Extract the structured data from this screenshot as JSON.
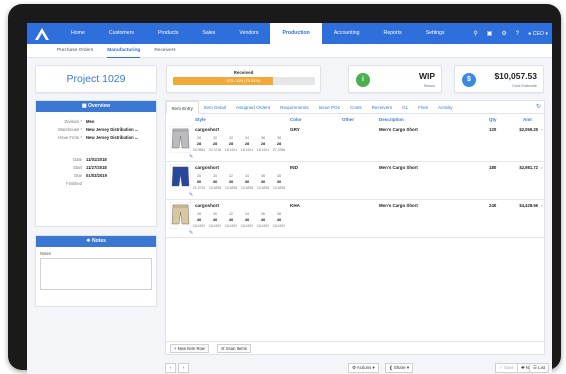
{
  "nav": {
    "items": [
      "Home",
      "Customers",
      "Products",
      "Sales",
      "Vendors",
      "Production",
      "Accounting",
      "Reports",
      "Settings"
    ],
    "active_index": 5,
    "user": "CEO",
    "icons": [
      "search-icon",
      "gift-icon",
      "gear-icon",
      "help-icon",
      "user-icon"
    ]
  },
  "subnav": {
    "items": [
      "Purchase Orders",
      "Manufacturing",
      "Receivers"
    ],
    "active_index": 1
  },
  "project": {
    "title": "Project 1029"
  },
  "received": {
    "label": "Received",
    "progress_text": "373 / 529 (70.51%)",
    "progress_fraction": 0.7051
  },
  "status": {
    "value": "WIP",
    "label": "Status",
    "icon_letter": "i"
  },
  "cost": {
    "value": "$10,057.53",
    "label": "Cost Estimate",
    "icon_letter": "$"
  },
  "overview": {
    "title": "Overview",
    "rows": [
      {
        "key": "Division *",
        "value": "Men"
      },
      {
        "key": "Warehouse *",
        "value": "New Jersey Distribution ..."
      },
      {
        "key": "Issue From *",
        "value": "New Jersey Distribution ..."
      },
      {
        "key": "Date",
        "value": "11/01/2018"
      },
      {
        "key": "Start",
        "value": "11/27/2018"
      },
      {
        "key": "Due",
        "value": "01/03/2019"
      },
      {
        "key": "Finished",
        "value": ""
      }
    ]
  },
  "notes": {
    "title": "Notes",
    "label": "Notes",
    "value": ""
  },
  "tabs": [
    "Item Entry",
    "Item Detail",
    "Assigned Orders",
    "Requirements",
    "Issue POs",
    "Costs",
    "Receivers",
    "GL",
    "Files",
    "Activity"
  ],
  "active_tab": 0,
  "grid": {
    "headers": {
      "style": "Style",
      "color": "Color",
      "other": "Other",
      "description": "Description",
      "qty": "Qty",
      "amount": "Amt"
    },
    "items": [
      {
        "style": "cargoshort",
        "color": "GRY",
        "description": "Men's Cargo Short",
        "qty": "120",
        "amount": "$2,059.25",
        "thumb_color": "#b9bbbd",
        "sizes": [
          "28",
          "30",
          "32",
          "34",
          "36",
          "38"
        ],
        "quantities": [
          "28",
          "28",
          "28",
          "28",
          "28",
          "28"
        ],
        "costs": [
          "24.9581",
          "23.3716",
          "18.4191",
          "18.4191",
          "18.4191",
          "27.2256"
        ]
      },
      {
        "style": "cargoshort",
        "color": "IND",
        "description": "Men's Cargo Short",
        "qty": "180",
        "amount": "$2,981.72",
        "thumb_color": "#27479c",
        "sizes": [
          "28",
          "30",
          "32",
          "34",
          "36",
          "38"
        ],
        "quantities": [
          "30",
          "30",
          "30",
          "30",
          "30",
          "30"
        ],
        "costs": [
          "21.9720",
          "15.4836",
          "15.4836",
          "15.4836",
          "15.4836",
          "15.4836"
        ]
      },
      {
        "style": "cargoshort",
        "color": "KHA",
        "description": "Men's Cargo Short",
        "qty": "240",
        "amount": "$4,428.56",
        "thumb_color": "#d8c7a0",
        "sizes": [
          "28",
          "30",
          "32",
          "34",
          "36",
          "38"
        ],
        "quantities": [
          "40",
          "40",
          "40",
          "40",
          "40",
          "40"
        ],
        "costs": [
          "18.4191",
          "18.4191",
          "18.4191",
          "18.4191",
          "18.4191",
          "18.4191"
        ]
      }
    ]
  },
  "grid_footer": {
    "new_item_row": "New Item Row",
    "scan_items": "Scan Items"
  },
  "bottom": {
    "actions": "Actions",
    "share": "Share",
    "save": "Save",
    "new": "New",
    "list": "List"
  },
  "colors": {
    "primary": "#2f6fdc",
    "accent_orange": "#f3a93a",
    "status_green": "#4caf50",
    "cost_blue": "#3a8be0"
  }
}
